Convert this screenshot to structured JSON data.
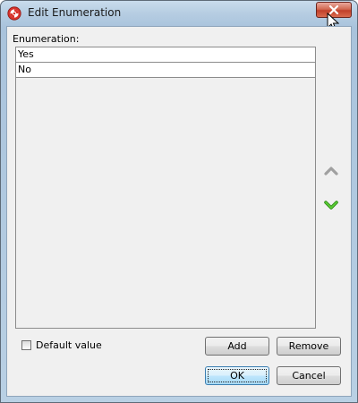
{
  "window": {
    "title": "Edit Enumeration",
    "icon": "visual-paradigm-app-icon"
  },
  "enumeration": {
    "label": "Enumeration:",
    "items": [
      "Yes",
      "No"
    ]
  },
  "reorder": {
    "up_icon": "move-up-icon",
    "down_icon": "move-down-icon",
    "down_color": "#3aa71f"
  },
  "default_value": {
    "label": "Default value",
    "checked": false
  },
  "buttons": {
    "add": "Add",
    "remove": "Remove",
    "ok": "OK",
    "cancel": "Cancel"
  },
  "colors": {
    "close_button": "#c9452e",
    "dialog_bg": "#f0f0f0",
    "frame": "#b6cde2"
  }
}
